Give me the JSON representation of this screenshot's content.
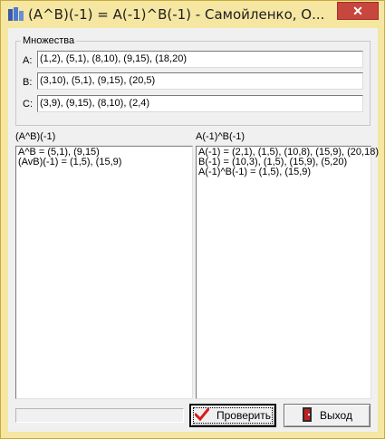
{
  "window": {
    "title": "(A^B)(-1) = A(-1)^B(-1) - Самойленко, О..."
  },
  "sets": {
    "group_label": "Множества",
    "rows": [
      {
        "label": "A:",
        "value": "(1,2), (5,1), (8,10), (9,15), (18,20)"
      },
      {
        "label": "B:",
        "value": "(3,10), (5,1), (9,15), (20,5)"
      },
      {
        "label": "C:",
        "value": "(3,9), (9,15), (8,10), (2,4)"
      }
    ]
  },
  "left_panel": {
    "label": "(A^B)(-1)",
    "lines": [
      "A^B = (5,1), (9,15)",
      "(AvB)(-1) = (1,5), (15,9)"
    ]
  },
  "right_panel": {
    "label": "A(-1)^B(-1)",
    "lines": [
      "A(-1) = (2,1), (1,5), (10,8), (15,9), (20,18)",
      "B(-1) = (10,3), (1,5), (15,9), (5,20)",
      "A(-1)^B(-1) = (1,5), (15,9)"
    ]
  },
  "buttons": {
    "check_label": "Проверить",
    "exit_label": "Выход"
  },
  "colors": {
    "frame": "#f5e6a2",
    "close": "#c7463e",
    "check_mark": "#d41e1e"
  }
}
